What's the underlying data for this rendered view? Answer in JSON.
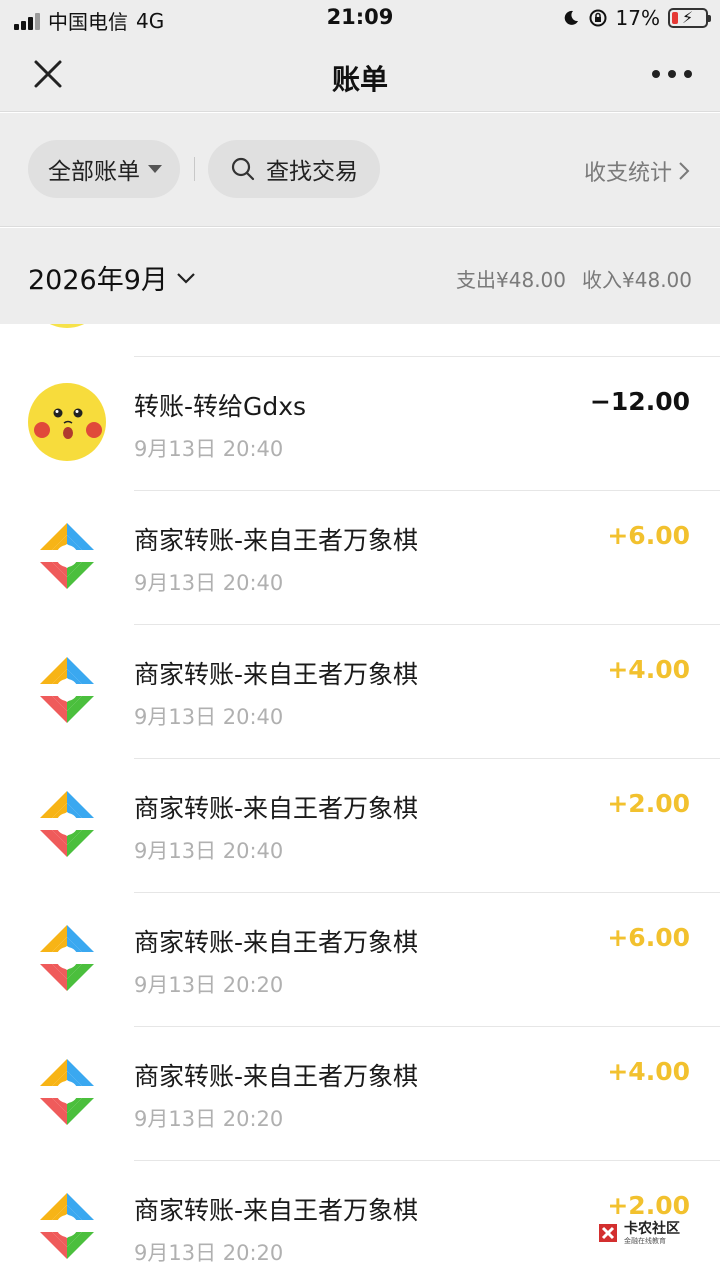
{
  "status_bar": {
    "carrier": "中国电信",
    "network": "4G",
    "time": "21:09",
    "battery": "17%"
  },
  "nav": {
    "title": "账单",
    "close_icon": "close-icon",
    "more_icon": "more-icon"
  },
  "filters": {
    "all_bills": "全部账单",
    "search": "查找交易",
    "stats": "收支统计",
    "stats_arrow": "›"
  },
  "month_header": {
    "month": "2026年9月",
    "expense": "支出¥48.00",
    "income": "收入¥48.00"
  },
  "transactions": [
    {
      "title": "转账-转给Gdxs",
      "time": "9月13日 20:40",
      "amount": "−12.00",
      "kind": "out",
      "avatar": "pikachu-avatar"
    },
    {
      "title": "商家转账-来自王者万象棋",
      "time": "9月13日 20:40",
      "amount": "+6.00",
      "kind": "in",
      "avatar": "merchant-logo"
    },
    {
      "title": "商家转账-来自王者万象棋",
      "time": "9月13日 20:40",
      "amount": "+4.00",
      "kind": "in",
      "avatar": "merchant-logo"
    },
    {
      "title": "商家转账-来自王者万象棋",
      "time": "9月13日 20:40",
      "amount": "+2.00",
      "kind": "in",
      "avatar": "merchant-logo"
    },
    {
      "title": "商家转账-来自王者万象棋",
      "time": "9月13日 20:20",
      "amount": "+6.00",
      "kind": "in",
      "avatar": "merchant-logo"
    },
    {
      "title": "商家转账-来自王者万象棋",
      "time": "9月13日 20:20",
      "amount": "+4.00",
      "kind": "in",
      "avatar": "merchant-logo"
    },
    {
      "title": "商家转账-来自王者万象棋",
      "time": "9月13日 20:20",
      "amount": "+2.00",
      "kind": "in",
      "avatar": "merchant-logo"
    }
  ],
  "watermark": {
    "main": "卡农社区",
    "sub": "金融在线教育"
  },
  "colors": {
    "income": "#f2c12e",
    "expense": "#111111",
    "background": "#ededed"
  }
}
